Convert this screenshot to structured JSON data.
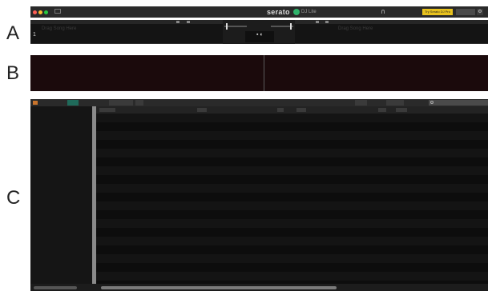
{
  "labels": {
    "a": "A",
    "b": "B",
    "c": "C"
  },
  "titlebar": {
    "brand": "serato",
    "subtitle": "DJ Lite",
    "upgrade_button": "Try Serato DJ Pro",
    "colors": {
      "close": "#ff5f57",
      "minimize": "#febc2e",
      "zoom": "#28c840",
      "upgrade": "#e8c21e",
      "brand_dot": "#2fb36b"
    }
  },
  "decks": {
    "left": {
      "number": "1",
      "title": "Drag Song Here"
    },
    "right": {
      "title": "Drag Song Here"
    }
  },
  "library": {
    "rows": 20,
    "colors": {
      "row_a": "#141414",
      "row_b": "#0d0d0d",
      "waveform_bg": "#1b0a0c"
    }
  }
}
